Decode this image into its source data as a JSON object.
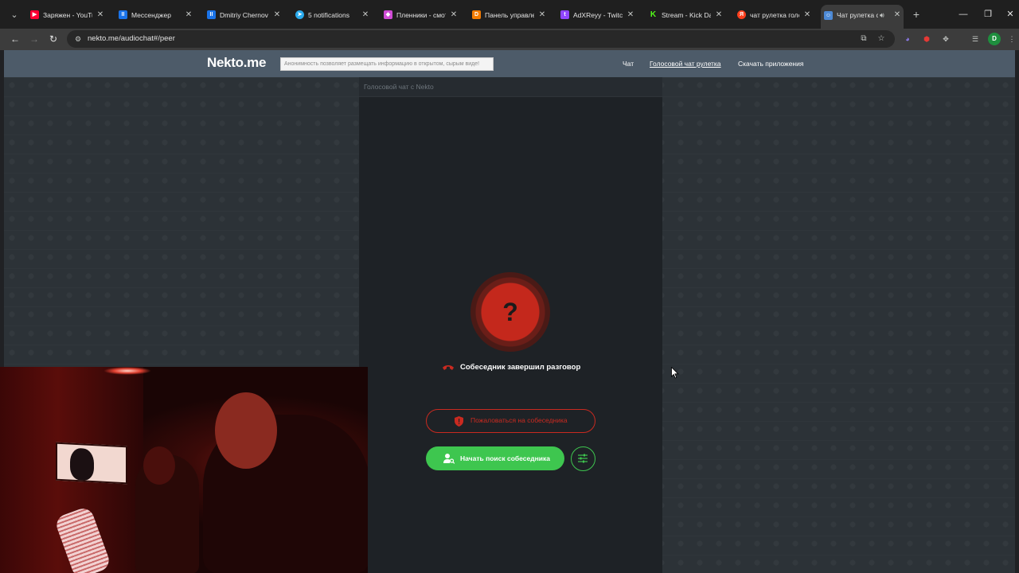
{
  "browser": {
    "tabs": [
      {
        "title": "Заряжен - YouTub",
        "favicon": "youtube-icon",
        "color": "#ff0033"
      },
      {
        "title": "Мессенджер",
        "favicon": "app-icon",
        "color": "#1a73e8"
      },
      {
        "title": "Dmitriy Chernov",
        "favicon": "app-icon",
        "color": "#1a73e8"
      },
      {
        "title": "5 notifications",
        "favicon": "telegram-icon",
        "color": "#2aabee"
      },
      {
        "title": "Пленники - смот",
        "favicon": "kinopoisk-icon",
        "color": "#d04bd6"
      },
      {
        "title": "Панель управлен",
        "favicon": "donationalerts-icon",
        "color": "#f57c00"
      },
      {
        "title": "AdXReyy - Twitch",
        "favicon": "twitch-icon",
        "color": "#9146ff"
      },
      {
        "title": "Stream - Kick Das",
        "favicon": "kick-icon",
        "color": "#53fc18"
      },
      {
        "title": "чат рулетка голо",
        "favicon": "yandex-icon",
        "color": "#fc3f1d"
      },
      {
        "title": "Чат рулетка с",
        "favicon": "nekto-icon",
        "color": "#4d8ad6",
        "active": true
      }
    ],
    "url": "nekto.me/audiochat#/peer",
    "profile_initial": "D"
  },
  "site": {
    "logo": "Nekto.me",
    "tagline": "Анонимность позволяет размещать информацию в открытом, сырым виде!",
    "nav": [
      "Чат",
      "Голосовой чат рулетка",
      "Скачать приложения"
    ],
    "accent_green": "#3ec64f",
    "accent_red": "#c92a20"
  },
  "chat": {
    "title": "Голосовой чат с Nekto",
    "status_icon": "question-icon",
    "status_glyph": "?",
    "end_message": "Собеседник завершил разговор",
    "report_button": "Пожаловаться на собеседника",
    "search_button": "Начать поиск собеседника"
  }
}
